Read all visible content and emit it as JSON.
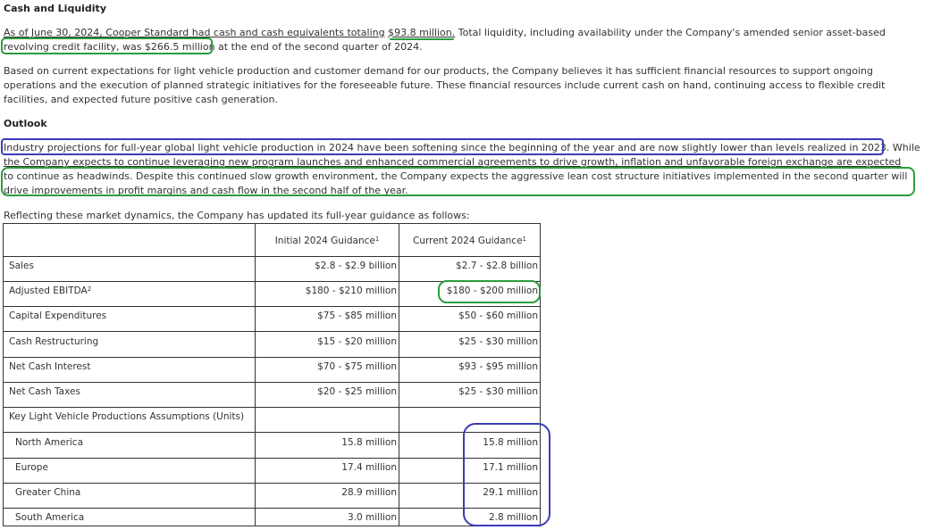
{
  "cash": {
    "heading": "Cash and Liquidity",
    "line1_a": "As of June 30, 2024, Cooper Standard had cash and cash equivalents totaling",
    "line1_b": "$93.8 million.",
    "line1_c": "Total liquidity, including availability under the Company's amended senior asset-based",
    "line2_a": "revolving credit facility, was $266.5 million",
    "line2_b": "at the end of the second quarter of 2024.",
    "p2_l1": "Based on current expectations for light vehicle production and customer demand for our products, the Company believes it has sufficient financial resources to support ongoing",
    "p2_l2": "operations and the execution of planned strategic initiatives for the foreseeable future. These financial resources include current cash on hand, continuing access to flexible credit",
    "p2_l3": "facilities, and expected future positive cash generation."
  },
  "outlook": {
    "heading": "Outlook",
    "l1_a": "Industry projections for full-year global light vehicle production in 2024 have been softening since the beginning of the year and are now slightly lower than levels realized in 2023.",
    "l1_b": "While",
    "l2": "the Company expects to continue leveraging new program launches and enhanced commercial agreements to drive growth, inflation and unfavorable foreign exchange are expected",
    "l3": "to continue as headwinds. Despite this continued slow growth environment, the Company expects the aggressive lean cost structure initiatives implemented in the second quarter will",
    "l4": "drive improvements in profit margins and cash flow in the second half of the year.",
    "intro": "Reflecting these market dynamics, the Company has updated its full-year guidance as follows:"
  },
  "table": {
    "col_initial": "Initial 2024 Guidance",
    "col_current": "Current 2024 Guidance",
    "footnote_mark": "1",
    "rows": [
      {
        "label": "Sales",
        "initial": "$2.8 - $2.9 billion",
        "current": "$2.7 - $2.8 billion"
      },
      {
        "label": "Adjusted EBITDA",
        "label_sup": "2",
        "initial": "$180 - $210 million",
        "current": "$180 - $200 million"
      },
      {
        "label": "Capital Expenditures",
        "initial": "$75 - $85 million",
        "current": "$50 - $60 million"
      },
      {
        "label": "Cash Restructuring",
        "initial": "$15 - $20 million",
        "current": "$25 - $30 million"
      },
      {
        "label": "Net Cash Interest",
        "initial": "$70 - $75 million",
        "current": "$93 - $95 million"
      },
      {
        "label": "Net Cash Taxes",
        "initial": "$20 - $25 million",
        "current": "$25 - $30 million"
      },
      {
        "label": "Key Light Vehicle Productions Assumptions (Units)",
        "initial": "",
        "current": ""
      },
      {
        "label": "North America",
        "initial": "15.8 million",
        "current": "15.8 million"
      },
      {
        "label": "Europe",
        "initial": "17.4 million",
        "current": "17.1 million"
      },
      {
        "label": "Greater China",
        "initial": "28.9 million",
        "current": "29.1 million"
      },
      {
        "label": "South America",
        "initial": "3.0 million",
        "current": "2.8 million"
      }
    ]
  },
  "colors": {
    "green_annotation": "#2a9d3c",
    "blue_annotation": "#3b3bb8",
    "text": "#333333"
  }
}
